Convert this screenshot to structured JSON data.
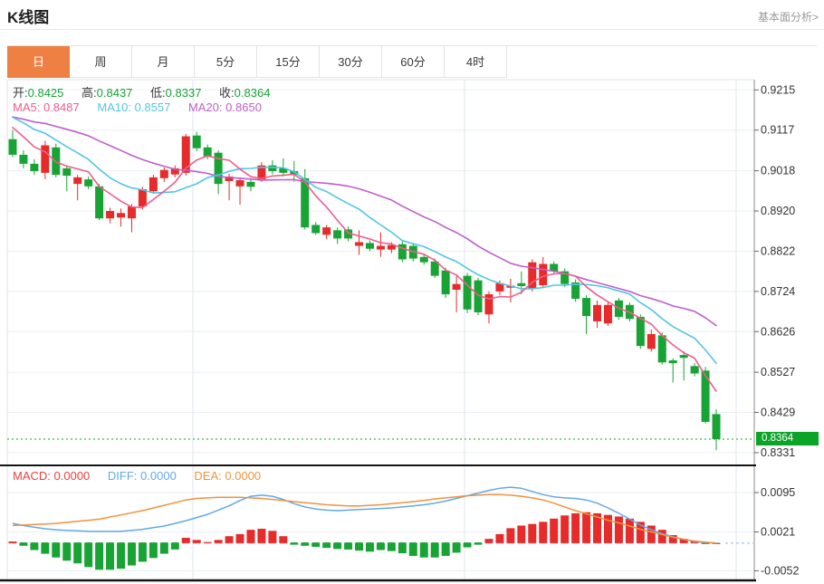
{
  "header": {
    "title": "K线图",
    "link_label": "基本面分析>"
  },
  "tabs": {
    "items": [
      "日",
      "周",
      "月",
      "5分",
      "15分",
      "30分",
      "60分",
      "4时"
    ],
    "active": "日"
  },
  "info_bar": {
    "open_label": "开:",
    "open": "0.8425",
    "high_label": "高:",
    "high": "0.8437",
    "low_label": "低:",
    "low": "0.8337",
    "close_label": "收:",
    "close": "0.8364"
  },
  "ma_bar": {
    "ma5_label": "MA5:",
    "ma5": "0.8487",
    "ma10_label": "MA10:",
    "ma10": "0.8557",
    "ma20_label": "MA20:",
    "ma20": "0.8650"
  },
  "macd_bar": {
    "macd_label": "MACD:",
    "macd": "0.0000",
    "diff_label": "DIFF:",
    "diff": "0.0000",
    "dea_label": "DEA:",
    "dea": "0.0000"
  },
  "chart_data": {
    "type": "candlestick",
    "title": "K线图 日K",
    "price_axis": {
      "ticks": [
        0.9215,
        0.9117,
        0.9018,
        0.892,
        0.8822,
        0.8724,
        0.8626,
        0.8527,
        0.8429,
        0.8331
      ],
      "range_top": 0.924,
      "range_bottom": 0.83
    },
    "last_price": 0.8364,
    "last_price_label": "0.8364",
    "candles": [
      [
        0.9095,
        0.9117,
        0.9051,
        0.9057
      ],
      [
        0.9057,
        0.9068,
        0.9024,
        0.9035
      ],
      [
        0.9035,
        0.9046,
        0.9008,
        0.9017
      ],
      [
        0.9013,
        0.9091,
        0.8998,
        0.908
      ],
      [
        0.9075,
        0.9084,
        0.9002,
        0.9008
      ],
      [
        0.9024,
        0.9031,
        0.8968,
        0.9006
      ],
      [
        0.8986,
        0.9008,
        0.8946,
        0.9002
      ],
      [
        0.8997,
        0.9004,
        0.8973,
        0.898
      ],
      [
        0.898,
        0.8986,
        0.8898,
        0.8902
      ],
      [
        0.8902,
        0.8928,
        0.889,
        0.892
      ],
      [
        0.8904,
        0.8926,
        0.8882,
        0.8915
      ],
      [
        0.8902,
        0.8937,
        0.8868,
        0.8931
      ],
      [
        0.8931,
        0.8979,
        0.8924,
        0.8973
      ],
      [
        0.8968,
        0.9008,
        0.8962,
        0.9002
      ],
      [
        0.9,
        0.9026,
        0.8991,
        0.902
      ],
      [
        0.9009,
        0.9031,
        0.9002,
        0.9024
      ],
      [
        0.9013,
        0.9108,
        0.9006,
        0.9102
      ],
      [
        0.9104,
        0.9113,
        0.9066,
        0.9073
      ],
      [
        0.9075,
        0.9082,
        0.9046,
        0.9053
      ],
      [
        0.9062,
        0.9068,
        0.8961,
        0.8986
      ],
      [
        0.8993,
        0.9011,
        0.8946,
        0.9004
      ],
      [
        0.898,
        0.9002,
        0.8935,
        0.8995
      ],
      [
        0.8991,
        0.8997,
        0.8968,
        0.8979
      ],
      [
        0.8997,
        0.9039,
        0.8991,
        0.9031
      ],
      [
        0.9031,
        0.9044,
        0.9009,
        0.9017
      ],
      [
        0.9024,
        0.9048,
        0.9004,
        0.9013
      ],
      [
        0.9017,
        0.9042,
        0.8991,
        0.9008
      ],
      [
        0.9,
        0.9022,
        0.8875,
        0.888
      ],
      [
        0.8886,
        0.8893,
        0.8862,
        0.8866
      ],
      [
        0.8862,
        0.8886,
        0.8851,
        0.888
      ],
      [
        0.8873,
        0.888,
        0.884,
        0.8853
      ],
      [
        0.8875,
        0.8882,
        0.8846,
        0.8853
      ],
      [
        0.8835,
        0.8873,
        0.8813,
        0.8844
      ],
      [
        0.8842,
        0.8848,
        0.8822,
        0.8828
      ],
      [
        0.8826,
        0.8868,
        0.8808,
        0.8835
      ],
      [
        0.8826,
        0.8844,
        0.8817,
        0.8837
      ],
      [
        0.8839,
        0.8846,
        0.8795,
        0.8802
      ],
      [
        0.8835,
        0.8842,
        0.8797,
        0.8804
      ],
      [
        0.8808,
        0.8815,
        0.8789,
        0.8795
      ],
      [
        0.8797,
        0.8804,
        0.8757,
        0.8762
      ],
      [
        0.8775,
        0.8782,
        0.8708,
        0.8717
      ],
      [
        0.8728,
        0.8762,
        0.8673,
        0.8742
      ],
      [
        0.8762,
        0.8769,
        0.8671,
        0.868
      ],
      [
        0.8751,
        0.8757,
        0.8666,
        0.8673
      ],
      [
        0.8668,
        0.8724,
        0.8646,
        0.8717
      ],
      [
        0.8724,
        0.8751,
        0.8715,
        0.8744
      ],
      [
        0.8733,
        0.8755,
        0.8697,
        0.8738
      ],
      [
        0.8744,
        0.8773,
        0.8717,
        0.8737
      ],
      [
        0.8731,
        0.8802,
        0.8724,
        0.8795
      ],
      [
        0.8739,
        0.8808,
        0.8733,
        0.8791
      ],
      [
        0.8791,
        0.8797,
        0.8766,
        0.8773
      ],
      [
        0.8773,
        0.878,
        0.8735,
        0.8742
      ],
      [
        0.8746,
        0.8753,
        0.8699,
        0.8706
      ],
      [
        0.8708,
        0.8715,
        0.862,
        0.8664
      ],
      [
        0.8651,
        0.8702,
        0.8635,
        0.8691
      ],
      [
        0.8646,
        0.8697,
        0.864,
        0.8691
      ],
      [
        0.8702,
        0.8708,
        0.8655,
        0.8662
      ],
      [
        0.8691,
        0.8697,
        0.8651,
        0.8657
      ],
      [
        0.8662,
        0.8668,
        0.8584,
        0.8591
      ],
      [
        0.8584,
        0.8631,
        0.8577,
        0.862
      ],
      [
        0.8617,
        0.8624,
        0.8546,
        0.8551
      ],
      [
        0.8556,
        0.8561,
        0.8502,
        0.8549
      ],
      [
        0.8569,
        0.8578,
        0.8507,
        0.8562
      ],
      [
        0.8542,
        0.8549,
        0.8517,
        0.8524
      ],
      [
        0.8531,
        0.854,
        0.8402,
        0.8406
      ],
      [
        0.8425,
        0.8437,
        0.8337,
        0.8364
      ]
    ],
    "prehistory_closes": [
      0.9152,
      0.915,
      0.9153,
      0.9149,
      0.9151,
      0.915,
      0.9152,
      0.9148,
      0.9151,
      0.915,
      0.9149,
      0.9172,
      0.9177,
      0.9175,
      0.9173,
      0.917,
      0.9148,
      0.9142,
      0.9138,
      0.9133
    ],
    "ma_windows": [
      20,
      10,
      5
    ],
    "macd": {
      "axis_ticks": [
        0.0095,
        0.0021,
        -0.0052
      ],
      "range_top": 0.0146,
      "range_bottom": -0.007,
      "diff": [
        0.0037,
        0.0033,
        0.003,
        0.0027,
        0.0025,
        0.0024,
        0.0023,
        0.0022,
        0.0022,
        0.0022,
        0.0022,
        0.0024,
        0.0026,
        0.0029,
        0.0032,
        0.0037,
        0.0042,
        0.0048,
        0.0054,
        0.0062,
        0.007,
        0.008,
        0.0088,
        0.009,
        0.0088,
        0.0082,
        0.0074,
        0.0068,
        0.0064,
        0.0062,
        0.0061,
        0.0062,
        0.0063,
        0.0064,
        0.0065,
        0.0066,
        0.0068,
        0.007,
        0.0072,
        0.0075,
        0.0079,
        0.0084,
        0.0089,
        0.0094,
        0.0099,
        0.0103,
        0.0105,
        0.0103,
        0.0097,
        0.0091,
        0.0087,
        0.0085,
        0.0084,
        0.0081,
        0.0075,
        0.0066,
        0.0056,
        0.0045,
        0.0034,
        0.0025,
        0.0018,
        0.0012,
        0.0007,
        0.0003,
        0.0001,
        0.0
      ],
      "dea": [
        0.0033,
        0.0034,
        0.0035,
        0.0036,
        0.0037,
        0.0039,
        0.0041,
        0.0043,
        0.0045,
        0.0049,
        0.0053,
        0.0057,
        0.0061,
        0.0066,
        0.0071,
        0.0076,
        0.0081,
        0.0084,
        0.0085,
        0.0086,
        0.0086,
        0.0086,
        0.0085,
        0.0084,
        0.0082,
        0.008,
        0.0078,
        0.0076,
        0.0074,
        0.0072,
        0.0071,
        0.007,
        0.007,
        0.0071,
        0.0072,
        0.0074,
        0.0076,
        0.0078,
        0.008,
        0.0083,
        0.0085,
        0.0087,
        0.0089,
        0.009,
        0.0091,
        0.0091,
        0.009,
        0.0088,
        0.0085,
        0.0081,
        0.0075,
        0.0068,
        0.0061,
        0.0055,
        0.0049,
        0.0043,
        0.0038,
        0.0032,
        0.0026,
        0.0021,
        0.0016,
        0.0011,
        0.0007,
        0.0004,
        0.0002,
        0.0
      ],
      "hist": [
        0.0003,
        -0.0005,
        -0.0013,
        -0.002,
        -0.0027,
        -0.0033,
        -0.0038,
        -0.0045,
        -0.005,
        -0.005,
        -0.0048,
        -0.0042,
        -0.0035,
        -0.0028,
        -0.002,
        -0.0012,
        0.001,
        0.0006,
        0.0002,
        0.0006,
        0.0013,
        0.0017,
        0.0025,
        0.0027,
        0.0023,
        0.0013,
        -0.0003,
        -0.0005,
        -0.0007,
        -0.0009,
        -0.0011,
        -0.0012,
        -0.0014,
        -0.0016,
        -0.0013,
        -0.0015,
        -0.0019,
        -0.0024,
        -0.0027,
        -0.0027,
        -0.0024,
        -0.0018,
        -0.0008,
        -0.0003,
        0.0008,
        0.0017,
        0.0028,
        0.0033,
        0.0036,
        0.004,
        0.0046,
        0.0052,
        0.0056,
        0.0058,
        0.0056,
        0.0053,
        0.005,
        0.0046,
        0.004,
        0.0033,
        0.0025,
        0.0015,
        0.0008,
        0.0004,
        -0.0001,
        0.0
      ]
    },
    "colors": {
      "up": "#e62b2b",
      "down": "#18a434",
      "ma5": "#ef5d8a",
      "ma10": "#52c5e6",
      "ma20": "#bf5ecb",
      "diff": "#61a9e8",
      "dea": "#f0923c",
      "grid": "#e9eef5",
      "vgrid": "#dde7f0",
      "border_light": "#e3e3e3",
      "axis_border": "#8a8a8a",
      "panel_border": "#141414",
      "zero_pos": "#b6d4ea",
      "zero_neg": "#2aa83c",
      "price_line": "#12a62c",
      "tag_bg": "#0aa427",
      "tag_text": "#ffffff",
      "tick_text": "#333333"
    }
  }
}
